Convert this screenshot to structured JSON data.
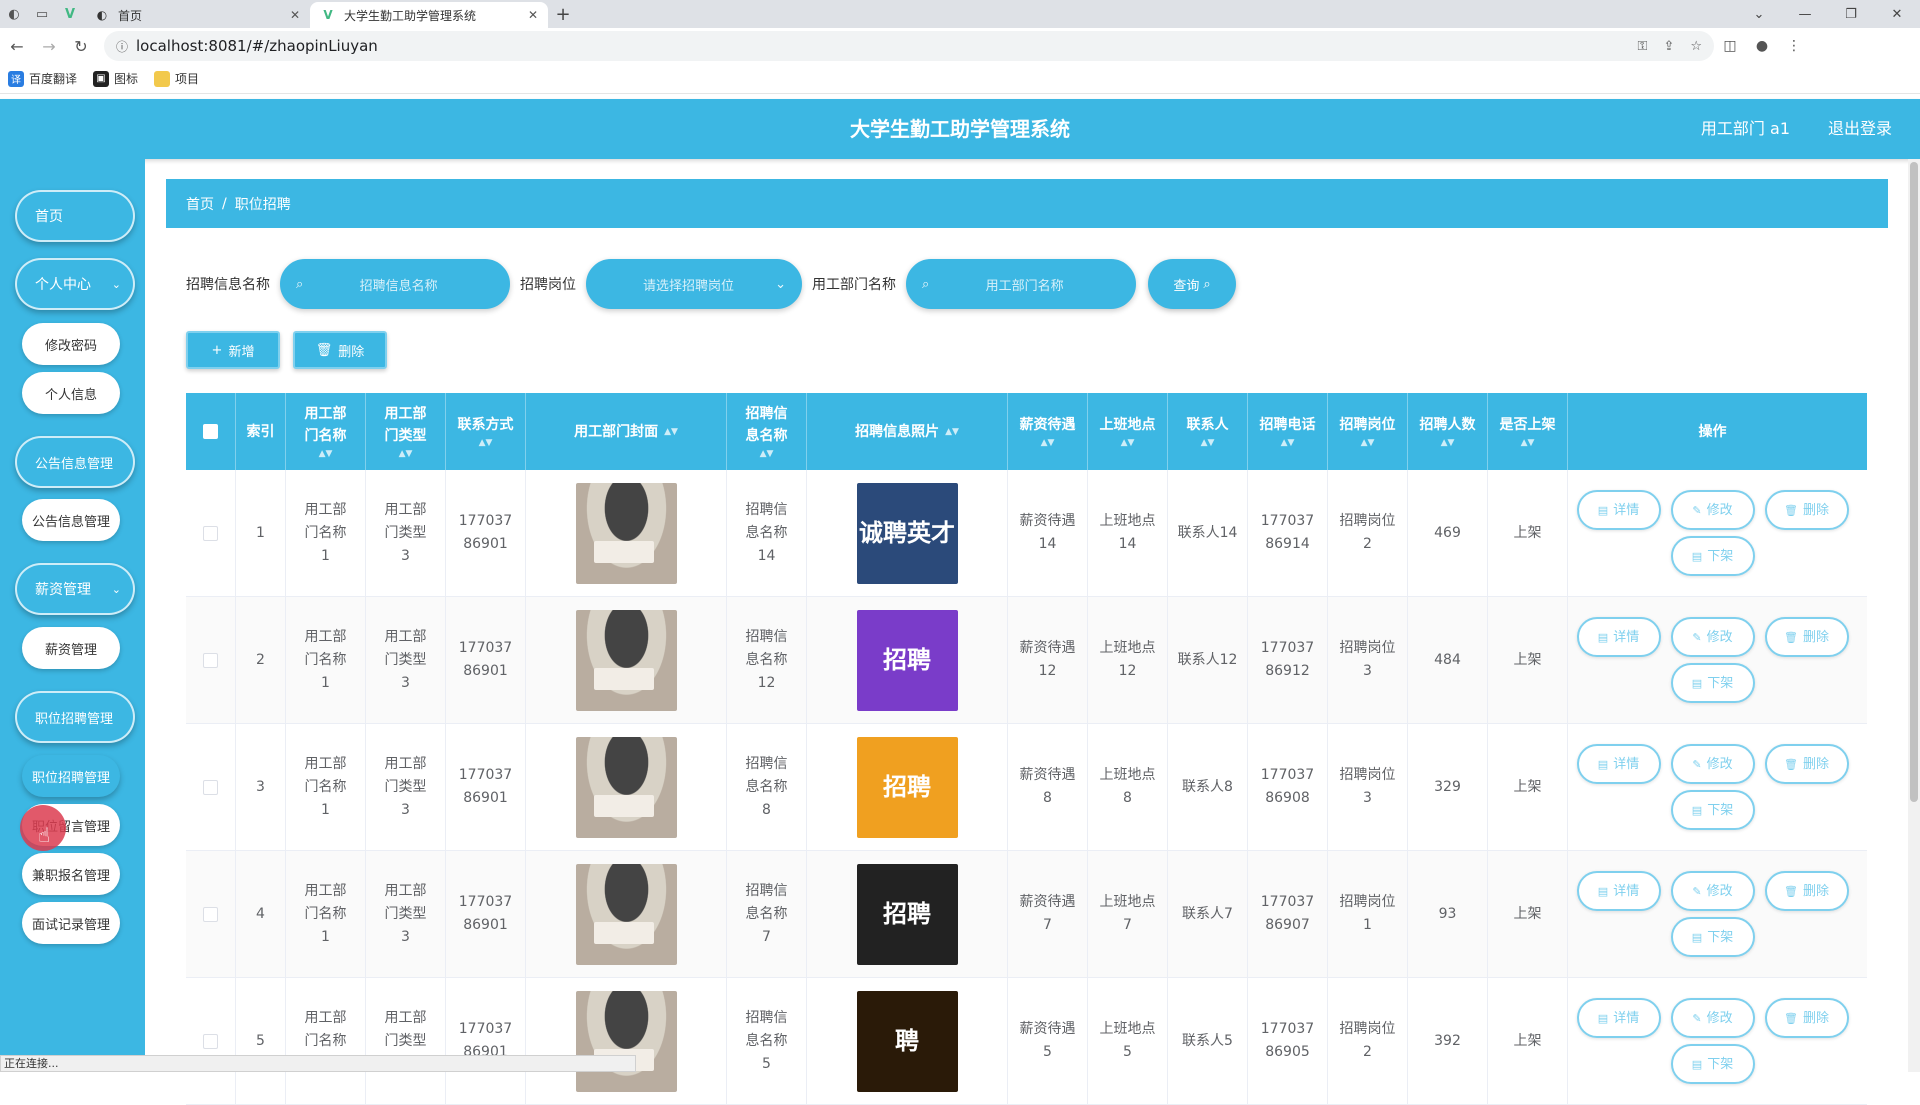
{
  "browser": {
    "tabs": [
      {
        "label": "首页",
        "active": false
      },
      {
        "label": "大学生勤工助学管理系统",
        "active": true
      }
    ],
    "url": "localhost:8081/#/zhaopinLiuyan",
    "bookmarks": [
      "百度翻译",
      "图标",
      "项目"
    ],
    "status": "正在连接..."
  },
  "header": {
    "title": "大学生勤工助学管理系统",
    "user": "用工部门 a1",
    "logout": "退出登录"
  },
  "sidebar": {
    "home": "首页",
    "personal": "个人中心",
    "change_password": "修改密码",
    "personal_info": "个人信息",
    "notice_group": "公告信息管理",
    "notice_manage": "公告信息管理",
    "salary_group": "薪资管理",
    "salary_manage": "薪资管理",
    "job_group": "职位招聘管理",
    "job_manage": "职位招聘管理",
    "job_comment": "职位留言管理",
    "parttime_signup": "兼职报名管理",
    "interview_records": "面试记录管理"
  },
  "breadcrumb": {
    "home": "首页",
    "current": "职位招聘"
  },
  "search": {
    "name_label": "招聘信息名称",
    "name_placeholder": "招聘信息名称",
    "post_label": "招聘岗位",
    "post_placeholder": "请选择招聘岗位",
    "dept_label": "用工部门名称",
    "dept_placeholder": "用工部门名称",
    "query": "查询"
  },
  "actions": {
    "add": "新增",
    "delete": "删除"
  },
  "columns": {
    "index": "索引",
    "dept_name": "用工部门名称",
    "dept_type": "用工部门类型",
    "contact": "联系方式",
    "dept_cover": "用工部门封面",
    "info_name": "招聘信息名称",
    "info_photo": "招聘信息照片",
    "salary": "薪资待遇",
    "location": "上班地点",
    "contact_person": "联系人",
    "phone": "招聘电话",
    "post": "招聘岗位",
    "count": "招聘人数",
    "listed": "是否上架",
    "ops": "操作"
  },
  "row_buttons": {
    "detail": "详情",
    "edit": "修改",
    "delete": "删除",
    "offline": "下架"
  },
  "rows": [
    {
      "index": "1",
      "dept_name": "用工部门名称1",
      "dept_type": "用工部门类型3",
      "contact": "17703786901",
      "info_name": "招聘信息名称14",
      "salary": "薪资待遇14",
      "location": "上班地点14",
      "contact_person": "联系人14",
      "phone": "17703786914",
      "post": "招聘岗位2",
      "count": "469",
      "listed": "上架",
      "poster_color": "#2b4a7a",
      "poster_text": "诚聘英才"
    },
    {
      "index": "2",
      "dept_name": "用工部门名称1",
      "dept_type": "用工部门类型3",
      "contact": "17703786901",
      "info_name": "招聘信息名称12",
      "salary": "薪资待遇12",
      "location": "上班地点12",
      "contact_person": "联系人12",
      "phone": "17703786912",
      "post": "招聘岗位3",
      "count": "484",
      "listed": "上架",
      "poster_color": "#7a3cc9",
      "poster_text": "招聘"
    },
    {
      "index": "3",
      "dept_name": "用工部门名称1",
      "dept_type": "用工部门类型3",
      "contact": "17703786901",
      "info_name": "招聘信息名称8",
      "salary": "薪资待遇8",
      "location": "上班地点8",
      "contact_person": "联系人8",
      "phone": "17703786908",
      "post": "招聘岗位3",
      "count": "329",
      "listed": "上架",
      "poster_color": "#f0a020",
      "poster_text": "招聘"
    },
    {
      "index": "4",
      "dept_name": "用工部门名称1",
      "dept_type": "用工部门类型3",
      "contact": "17703786901",
      "info_name": "招聘信息名称7",
      "salary": "薪资待遇7",
      "location": "上班地点7",
      "contact_person": "联系人7",
      "phone": "17703786907",
      "post": "招聘岗位1",
      "count": "93",
      "listed": "上架",
      "poster_color": "#222222",
      "poster_text": "招聘"
    },
    {
      "index": "5",
      "dept_name": "用工部门名称1",
      "dept_type": "用工部门类型3",
      "contact": "17703786901",
      "info_name": "招聘信息名称5",
      "salary": "薪资待遇5",
      "location": "上班地点5",
      "contact_person": "联系人5",
      "phone": "17703786905",
      "post": "招聘岗位2",
      "count": "392",
      "listed": "上架",
      "poster_color": "#2a1a08",
      "poster_text": "聘"
    }
  ]
}
